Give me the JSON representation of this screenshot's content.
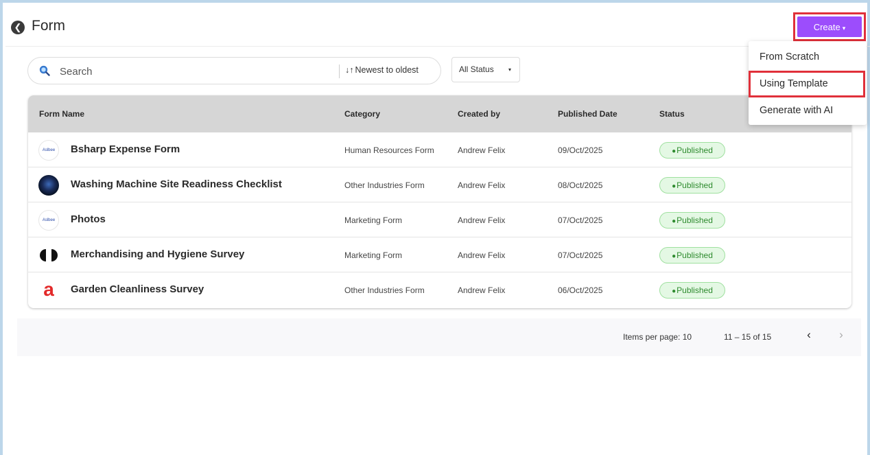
{
  "header": {
    "title": "Form",
    "back_icon": "back-circle-icon",
    "create_label": "Create",
    "create_caret": "▾",
    "create_color": "#9c4dfc",
    "highlight_color": "#e0303a"
  },
  "create_menu": {
    "items": [
      {
        "label": "From Scratch"
      },
      {
        "label": "Using Template",
        "highlighted": true
      },
      {
        "label": "Generate with AI"
      }
    ]
  },
  "toolbar": {
    "search_placeholder": "Search",
    "sort_icon": "↓↑",
    "sort_label": "Newest to oldest",
    "status_filter": "All Status",
    "status_caret": "▾"
  },
  "table": {
    "columns": [
      "Form Name",
      "Category",
      "Created by",
      "Published Date",
      "Status"
    ],
    "rows": [
      {
        "avatar": "logo",
        "logo_text": "Aslbee",
        "name": "Bsharp Expense Form",
        "category": "Human Resources Form",
        "created_by": "Andrew Felix",
        "date": "09/Oct/2025",
        "status": "Published"
      },
      {
        "avatar": "dark",
        "name": "Washing Machine Site Readiness Checklist",
        "category": "Other Industries Form",
        "created_by": "Andrew Felix",
        "date": "08/Oct/2025",
        "status": "Published"
      },
      {
        "avatar": "logo",
        "logo_text": "Aslbee",
        "name": "Photos",
        "category": "Marketing Form",
        "created_by": "Andrew Felix",
        "date": "07/Oct/2025",
        "status": "Published"
      },
      {
        "avatar": "pill",
        "name": "Merchandising and Hygiene Survey",
        "category": "Marketing Form",
        "created_by": "Andrew Felix",
        "date": "07/Oct/2025",
        "status": "Published"
      },
      {
        "avatar": "letter",
        "avatar_letter": "a",
        "name": "Garden Cleanliness Survey",
        "category": "Other Industries Form",
        "created_by": "Andrew Felix",
        "date": "06/Oct/2025",
        "status": "Published"
      }
    ],
    "status_color": "#2e8b2e"
  },
  "pagination": {
    "items_per_page": "Items per page: 10",
    "range": "11 – 15 of 15",
    "prev_glyph": "‹",
    "next_glyph": "›"
  }
}
